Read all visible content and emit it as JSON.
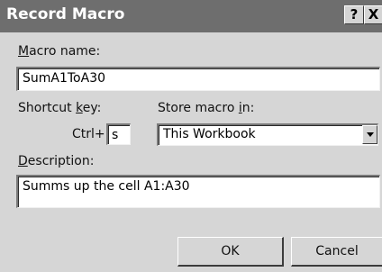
{
  "window": {
    "title": "Record Macro",
    "help_glyph": "?",
    "close_glyph": "X"
  },
  "macro_name": {
    "label_accel": "M",
    "label_rest": "acro name:",
    "value": "SumA1ToA30"
  },
  "shortcut": {
    "label_pre": "Shortcut ",
    "label_accel": "k",
    "label_post": "ey:",
    "prefix": "Ctrl+",
    "value": "s"
  },
  "store_in": {
    "label_pre": "Store macro ",
    "label_accel": "i",
    "label_post": "n:",
    "selected": "This Workbook"
  },
  "description": {
    "label_accel": "D",
    "label_rest": "escription:",
    "value": "Summs up the cell A1:A30"
  },
  "buttons": {
    "ok": "OK",
    "cancel": "Cancel"
  },
  "colors": {
    "titlebar": "#6e6e6e",
    "dialog_face": "#d6d6d6",
    "field_bg": "#ffffff"
  }
}
